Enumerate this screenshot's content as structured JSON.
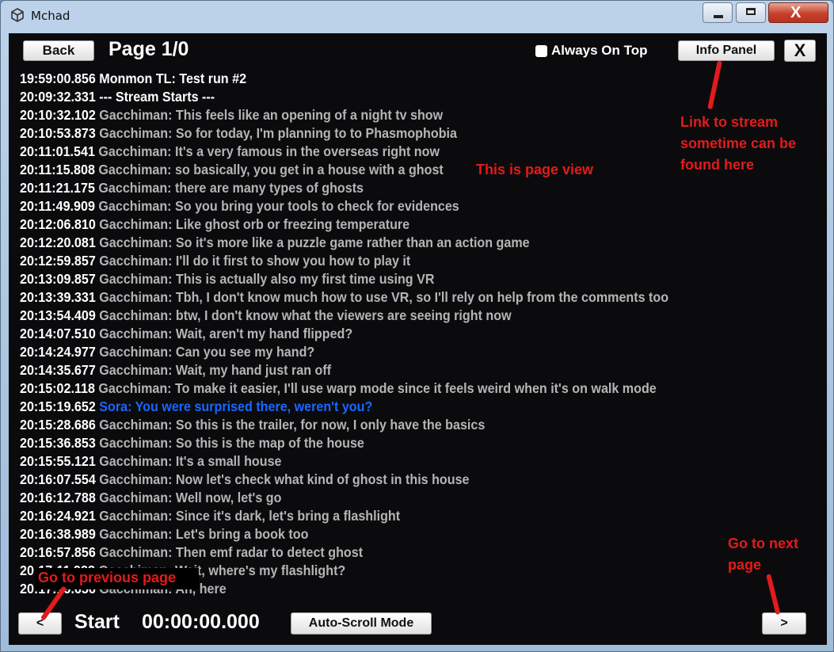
{
  "window": {
    "title": "Mchad",
    "icon": "unity-icon",
    "controls": [
      "minimize-icon",
      "maximize-icon",
      "close-icon"
    ],
    "close_glyph": "X"
  },
  "header": {
    "back_label": "Back",
    "page_label": "Page 1/0",
    "always_on_top_label": "Always On Top",
    "always_on_top_checked": false,
    "info_panel_label": "Info Panel",
    "close_label": "X"
  },
  "log": [
    {
      "time": "19:59:00.856",
      "text": "Monmon TL: Test run #2",
      "style": "w"
    },
    {
      "time": "20:09:32.331",
      "text": "--- Stream Starts ---",
      "style": "w"
    },
    {
      "time": "20:10:32.102",
      "text": "Gacchiman: This feels like an opening of a night tv show",
      "style": "n"
    },
    {
      "time": "20:10:53.873",
      "text": "Gacchiman: So for today, I'm planning to to Phasmophobia",
      "style": "n"
    },
    {
      "time": "20:11:01.541",
      "text": "Gacchiman: It's a very famous in the overseas right now",
      "style": "n"
    },
    {
      "time": "20:11:15.808",
      "text": "Gacchiman: so basically, you get in a house with a ghost",
      "style": "n"
    },
    {
      "time": "20:11:21.175",
      "text": "Gacchiman: there are many types of ghosts",
      "style": "n"
    },
    {
      "time": "20:11:49.909",
      "text": "Gacchiman: So you bring your tools to check for evidences",
      "style": "n"
    },
    {
      "time": "20:12:06.810",
      "text": "Gacchiman: Like ghost orb or freezing temperature",
      "style": "n"
    },
    {
      "time": "20:12:20.081",
      "text": "Gacchiman: So it's more like a puzzle game rather than an action game",
      "style": "n"
    },
    {
      "time": "20:12:59.857",
      "text": "Gacchiman: I'll do it first to show you how to play it",
      "style": "n"
    },
    {
      "time": "20:13:09.857",
      "text": "Gacchiman: This is actually also my first time using VR",
      "style": "n"
    },
    {
      "time": "20:13:39.331",
      "text": "Gacchiman: Tbh, I don't know much how to use VR, so I'll rely on help from the comments too",
      "style": "n"
    },
    {
      "time": "20:13:54.409",
      "text": "Gacchiman: btw, I don't know what the viewers are seeing right now",
      "style": "n"
    },
    {
      "time": "20:14:07.510",
      "text": "Gacchiman: Wait, aren't my hand flipped?",
      "style": "n"
    },
    {
      "time": "20:14:24.977",
      "text": "Gacchiman: Can you see my hand?",
      "style": "n"
    },
    {
      "time": "20:14:35.677",
      "text": "Gacchiman: Wait, my hand just ran off",
      "style": "n"
    },
    {
      "time": "20:15:02.118",
      "text": "Gacchiman: To make it easier, I'll use warp mode since it feels weird when it's on walk mode",
      "style": "n"
    },
    {
      "time": "20:15:19.652",
      "text": "Sora: You were surprised there, weren't you?",
      "style": "hl"
    },
    {
      "time": "20:15:28.686",
      "text": "Gacchiman: So this is the trailer, for now, I only have the basics",
      "style": "n"
    },
    {
      "time": "20:15:36.853",
      "text": "Gacchiman: So this is the map of the house",
      "style": "n"
    },
    {
      "time": "20:15:55.121",
      "text": "Gacchiman: It's a small house",
      "style": "n"
    },
    {
      "time": "20:16:07.554",
      "text": "Gacchiman: Now let's check what kind of ghost in this house",
      "style": "n"
    },
    {
      "time": "20:16:12.788",
      "text": "Gacchiman: Well now, let's go",
      "style": "n"
    },
    {
      "time": "20:16:24.921",
      "text": "Gacchiman: Since it's dark, let's bring a flashlight",
      "style": "n"
    },
    {
      "time": "20:16:38.989",
      "text": "Gacchiman: Let's bring a book too",
      "style": "n"
    },
    {
      "time": "20:16:57.856",
      "text": "Gacchiman: Then emf radar to detect ghost",
      "style": "n"
    },
    {
      "time": "20:17:11.923",
      "text": "Gacchiman: Wait, where's my flashlight?",
      "style": "n"
    },
    {
      "time": "20:17:19.656",
      "text": "Gacchiman: Ah, here",
      "style": "n"
    }
  ],
  "footer": {
    "prev_label": "<",
    "start_label": "Start",
    "time_label": "00:00:00.000",
    "autoscroll_label": "Auto-Scroll Mode",
    "next_label": ">"
  },
  "annotations": {
    "info_panel_note": "Link to stream\nsometime can be\nfound here",
    "page_view_note": "This is page view",
    "next_page_note": "Go to next\npage",
    "prev_page_note": "Go to previous page"
  },
  "colors": {
    "background": "#0b0b0d",
    "timestamp": "#ffffff",
    "message": "#b5b5b5",
    "highlight": "#1a66ff",
    "annotation": "#e21b1b"
  }
}
